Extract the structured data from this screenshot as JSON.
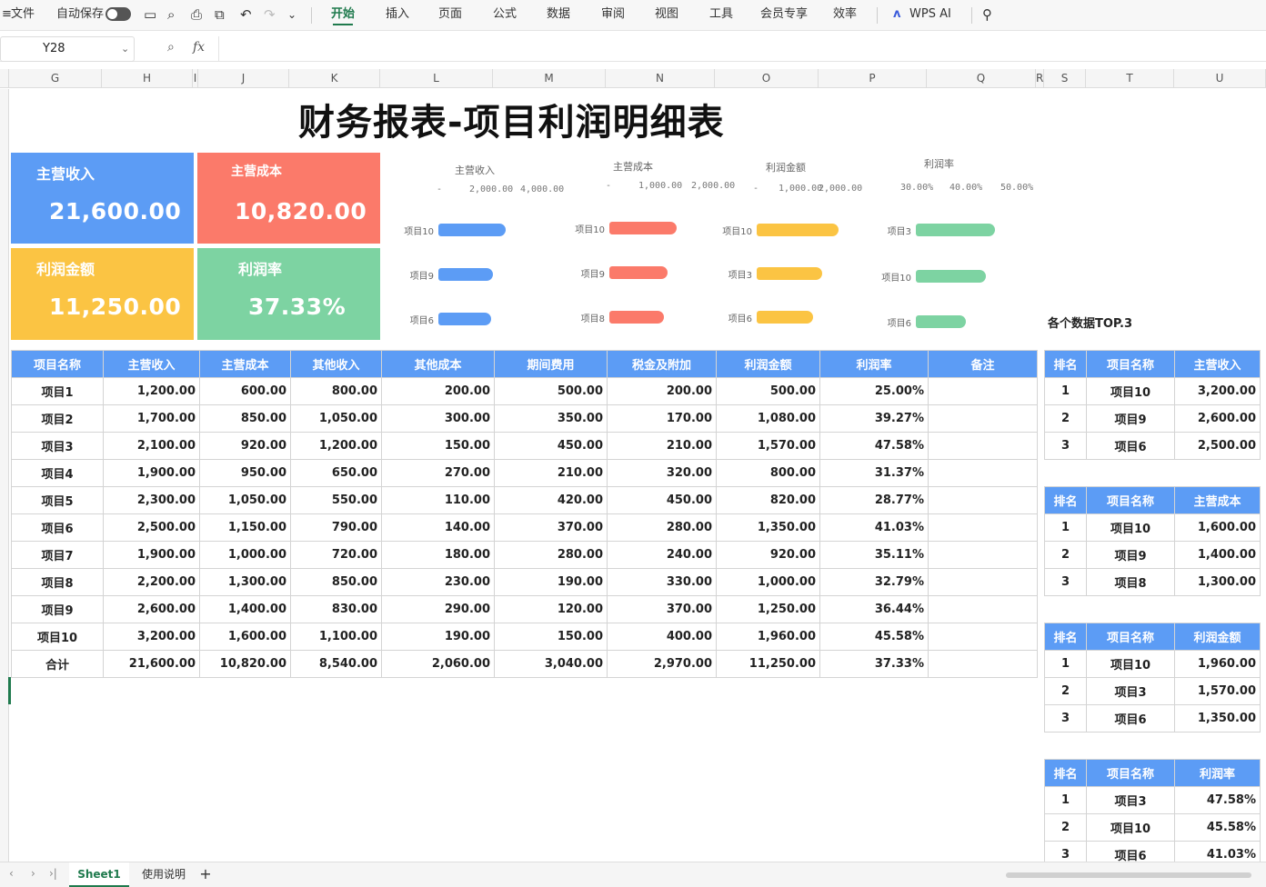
{
  "toolbar": {
    "file": "文件",
    "autosave": "自动保存",
    "tabs": [
      "开始",
      "插入",
      "页面",
      "公式",
      "数据",
      "审阅",
      "视图",
      "工具",
      "会员专享",
      "效率"
    ],
    "ai": "WPS AI"
  },
  "formula": {
    "cell": "Y28",
    "fx": "fx"
  },
  "columns": [
    "G",
    "H",
    "I",
    "J",
    "K",
    "L",
    "M",
    "N",
    "O",
    "P",
    "Q",
    "R",
    "S",
    "T",
    "U"
  ],
  "title": "财务报表-项目利润明细表",
  "cards": [
    {
      "label": "主营收入",
      "value": "21,600.00",
      "color": "#5c9cf5"
    },
    {
      "label": "主营成本",
      "value": "10,820.00",
      "color": "#fb7a6a"
    },
    {
      "label": "利润金额",
      "value": "11,250.00",
      "color": "#fbc443"
    },
    {
      "label": "利润率",
      "value": "37.33%",
      "color": "#7dd3a2"
    }
  ],
  "chart_data": [
    {
      "type": "bar",
      "title": "主营收入",
      "ticks": [
        "-",
        "2,000.00",
        "4,000.00"
      ],
      "xlim": [
        0,
        4000
      ],
      "categories": [
        "项目10",
        "项目9",
        "项目6"
      ],
      "values": [
        3200,
        2600,
        2500
      ],
      "color": "#5c9cf5"
    },
    {
      "type": "bar",
      "title": "主营成本",
      "ticks": [
        "-",
        "1,000.00",
        "2,000.00"
      ],
      "xlim": [
        0,
        2000
      ],
      "categories": [
        "项目10",
        "项目9",
        "项目8"
      ],
      "values": [
        1600,
        1400,
        1300
      ],
      "color": "#fb7a6a"
    },
    {
      "type": "bar",
      "title": "利润金额",
      "ticks": [
        "-",
        "1,000.00",
        "2,000.00"
      ],
      "xlim": [
        0,
        2000
      ],
      "categories": [
        "项目10",
        "项目3",
        "项目6"
      ],
      "values": [
        1960,
        1570,
        1350
      ],
      "color": "#fbc443"
    },
    {
      "type": "bar",
      "title": "利润率",
      "ticks": [
        "30.00%",
        "40.00%",
        "50.00%"
      ],
      "xlim": [
        30,
        50
      ],
      "categories": [
        "项目3",
        "项目10",
        "项目6"
      ],
      "values": [
        47.58,
        45.58,
        41.03
      ],
      "color": "#7dd3a2"
    }
  ],
  "table": {
    "headers": [
      "项目名称",
      "主营收入",
      "主营成本",
      "其他收入",
      "其他成本",
      "期间费用",
      "税金及附加",
      "利润金额",
      "利润率",
      "备注"
    ],
    "rows": [
      [
        "项目1",
        "1,200.00",
        "600.00",
        "800.00",
        "200.00",
        "500.00",
        "200.00",
        "500.00",
        "25.00%",
        ""
      ],
      [
        "项目2",
        "1,700.00",
        "850.00",
        "1,050.00",
        "300.00",
        "350.00",
        "170.00",
        "1,080.00",
        "39.27%",
        ""
      ],
      [
        "项目3",
        "2,100.00",
        "920.00",
        "1,200.00",
        "150.00",
        "450.00",
        "210.00",
        "1,570.00",
        "47.58%",
        ""
      ],
      [
        "项目4",
        "1,900.00",
        "950.00",
        "650.00",
        "270.00",
        "210.00",
        "320.00",
        "800.00",
        "31.37%",
        ""
      ],
      [
        "项目5",
        "2,300.00",
        "1,050.00",
        "550.00",
        "110.00",
        "420.00",
        "450.00",
        "820.00",
        "28.77%",
        ""
      ],
      [
        "项目6",
        "2,500.00",
        "1,150.00",
        "790.00",
        "140.00",
        "370.00",
        "280.00",
        "1,350.00",
        "41.03%",
        ""
      ],
      [
        "项目7",
        "1,900.00",
        "1,000.00",
        "720.00",
        "180.00",
        "280.00",
        "240.00",
        "920.00",
        "35.11%",
        ""
      ],
      [
        "项目8",
        "2,200.00",
        "1,300.00",
        "850.00",
        "230.00",
        "190.00",
        "330.00",
        "1,000.00",
        "32.79%",
        ""
      ],
      [
        "项目9",
        "2,600.00",
        "1,400.00",
        "830.00",
        "290.00",
        "120.00",
        "370.00",
        "1,250.00",
        "36.44%",
        ""
      ],
      [
        "项目10",
        "3,200.00",
        "1,600.00",
        "1,100.00",
        "190.00",
        "150.00",
        "400.00",
        "1,960.00",
        "45.58%",
        ""
      ],
      [
        "合计",
        "21,600.00",
        "10,820.00",
        "8,540.00",
        "2,060.00",
        "3,040.00",
        "2,970.00",
        "11,250.00",
        "37.33%",
        ""
      ]
    ]
  },
  "top3": {
    "title": "各个数据TOP.3",
    "tables": [
      {
        "headers": [
          "排名",
          "项目名称",
          "主营收入"
        ],
        "rows": [
          [
            "1",
            "项目10",
            "3,200.00"
          ],
          [
            "2",
            "项目9",
            "2,600.00"
          ],
          [
            "3",
            "项目6",
            "2,500.00"
          ]
        ]
      },
      {
        "headers": [
          "排名",
          "项目名称",
          "主营成本"
        ],
        "rows": [
          [
            "1",
            "项目10",
            "1,600.00"
          ],
          [
            "2",
            "项目9",
            "1,400.00"
          ],
          [
            "3",
            "项目8",
            "1,300.00"
          ]
        ]
      },
      {
        "headers": [
          "排名",
          "项目名称",
          "利润金额"
        ],
        "rows": [
          [
            "1",
            "项目10",
            "1,960.00"
          ],
          [
            "2",
            "项目3",
            "1,570.00"
          ],
          [
            "3",
            "项目6",
            "1,350.00"
          ]
        ]
      },
      {
        "headers": [
          "排名",
          "项目名称",
          "利润率"
        ],
        "rows": [
          [
            "1",
            "项目3",
            "47.58%"
          ],
          [
            "2",
            "项目10",
            "45.58%"
          ],
          [
            "3",
            "项目6",
            "41.03%"
          ]
        ]
      }
    ]
  },
  "sheets": {
    "active": "Sheet1",
    "other": "使用说明",
    "add": "+"
  }
}
